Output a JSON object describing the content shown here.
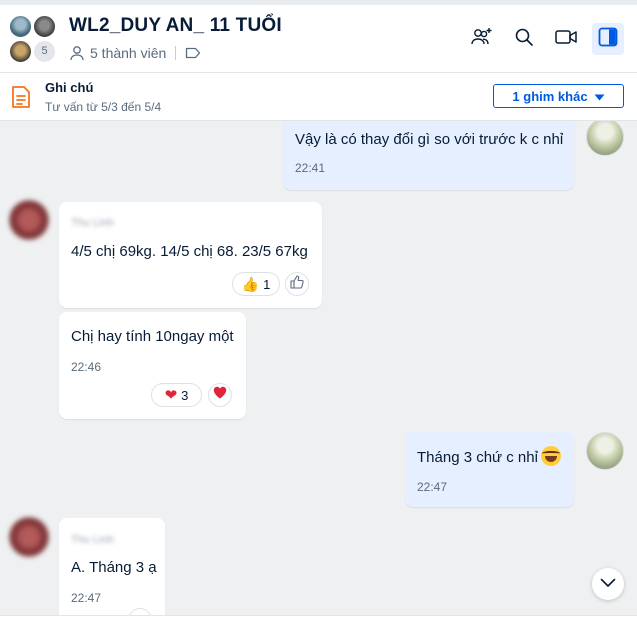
{
  "header": {
    "title": "WL2_DUY AN_ 11 TUỔI",
    "members": "5 thành viên",
    "member_count_badge": "5",
    "icons": [
      "add-member-icon",
      "search-icon",
      "video-call-icon",
      "sidebar-toggle-icon"
    ]
  },
  "note": {
    "title": "Ghi chú",
    "subtitle": "Tư vấn từ 5/3 đến 5/4",
    "pin_button": "1 ghim khác"
  },
  "messages": [
    {
      "direction": "out",
      "text": "Vậy là có thay đổi gì so với trước k c nhỉ",
      "time": "22:41"
    },
    {
      "direction": "in",
      "sender": "Thu Linh",
      "text": "4/5 chị 69kg. 14/5 chị 68. 23/5 67kg",
      "reaction": "👍",
      "reaction_count": "1"
    },
    {
      "direction": "in",
      "text": "Chị hay tính 10ngay một",
      "time": "22:46",
      "reaction": "❤",
      "reaction_count": "3"
    },
    {
      "direction": "out",
      "text": "Tháng 3 chứ c nhỉ",
      "time": "22:47"
    },
    {
      "direction": "in",
      "sender": "Thu Linh",
      "text": "A. Tháng 3 ạ",
      "time": "22:47"
    }
  ],
  "colors": {
    "accent": "#005ae0",
    "outgoing_bubble": "#e5efff",
    "background": "#eef0f1"
  }
}
